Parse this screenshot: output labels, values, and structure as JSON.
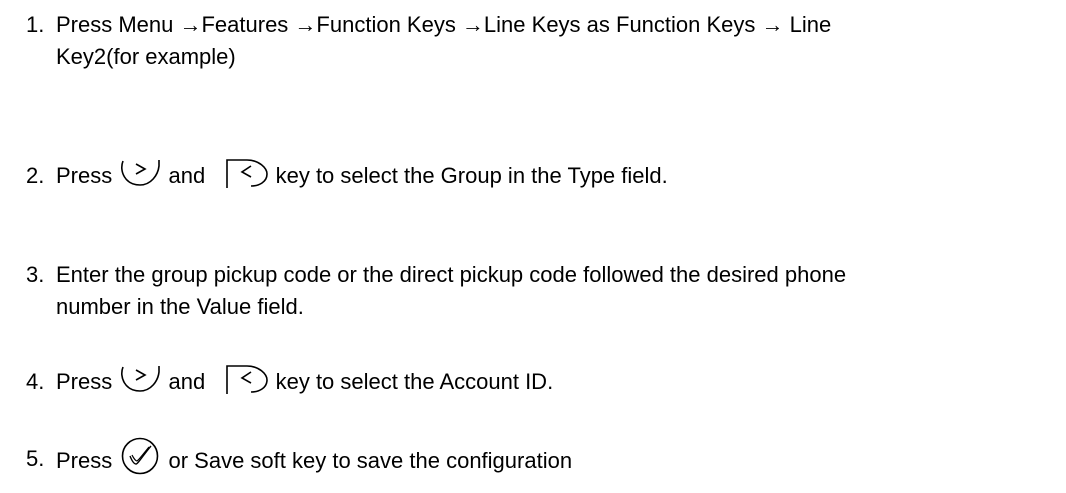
{
  "steps": [
    {
      "number": "1.",
      "line1": "Press Menu →Features →Function Keys →Line Keys as Function Keys → Line",
      "line2": "Key2(for example)"
    },
    {
      "number": "2.",
      "before": "Press",
      "middle": "and",
      "after": "key to select the Group in the Type  field.",
      "icons": [
        "right-navigation-key-icon",
        "left-navigation-key-icon"
      ]
    },
    {
      "number": "3.",
      "line1": "Enter the group pickup code or the direct pickup code followed the desired phone",
      "line2": "number in the Value field."
    },
    {
      "number": "4.",
      "before": "Press",
      "middle": "and",
      "after": "key to select the Account ID.",
      "icons": [
        "right-navigation-key-icon",
        "left-navigation-key-icon"
      ]
    },
    {
      "number": "5.",
      "before": "Press",
      "after": "or Save soft key to save the configuration",
      "icons": [
        "ok-key-icon"
      ]
    }
  ]
}
